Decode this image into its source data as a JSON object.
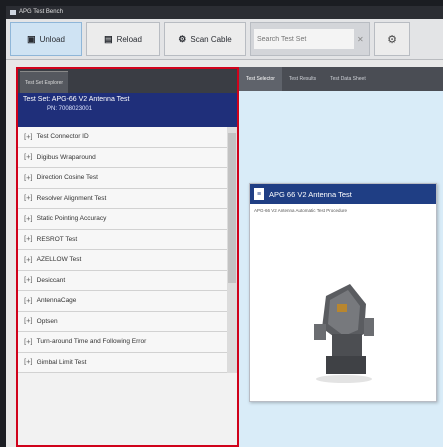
{
  "window": {
    "title": "APG Test Bench"
  },
  "toolbar": {
    "unload_label": "Unload",
    "reload_label": "Reload",
    "scan_label": "Scan Cable",
    "search_placeholder": "Search Test Set",
    "accent": "#cfe3f3"
  },
  "left_panel": {
    "tab_label": "Test Set Explorer",
    "testset_title": "Test Set: APG-66 V2 Antenna Test",
    "testset_pn": "PN: 7008023001",
    "items": [
      "Test Connector ID",
      "Digibus Wraparound",
      "Direction Cosine Test",
      "Resolver Alignment Test",
      "Static Pointing Accuracy",
      "RESROT Test",
      "AZELLOW Test",
      "Desiccant",
      "AntennaCage",
      "Optsen",
      "Turn-around Time and Following Error",
      "Gimbal Limit Test"
    ],
    "border_color": "#d0021b"
  },
  "right_panel": {
    "tabs": [
      "Test Selector",
      "Test Results",
      "Test Data Sheet"
    ],
    "card": {
      "title": "APG 66 V2 Antenna Test",
      "description": "APG-66 V2 Antenna Automatic Test Procedure",
      "icon": "document-icon"
    }
  }
}
